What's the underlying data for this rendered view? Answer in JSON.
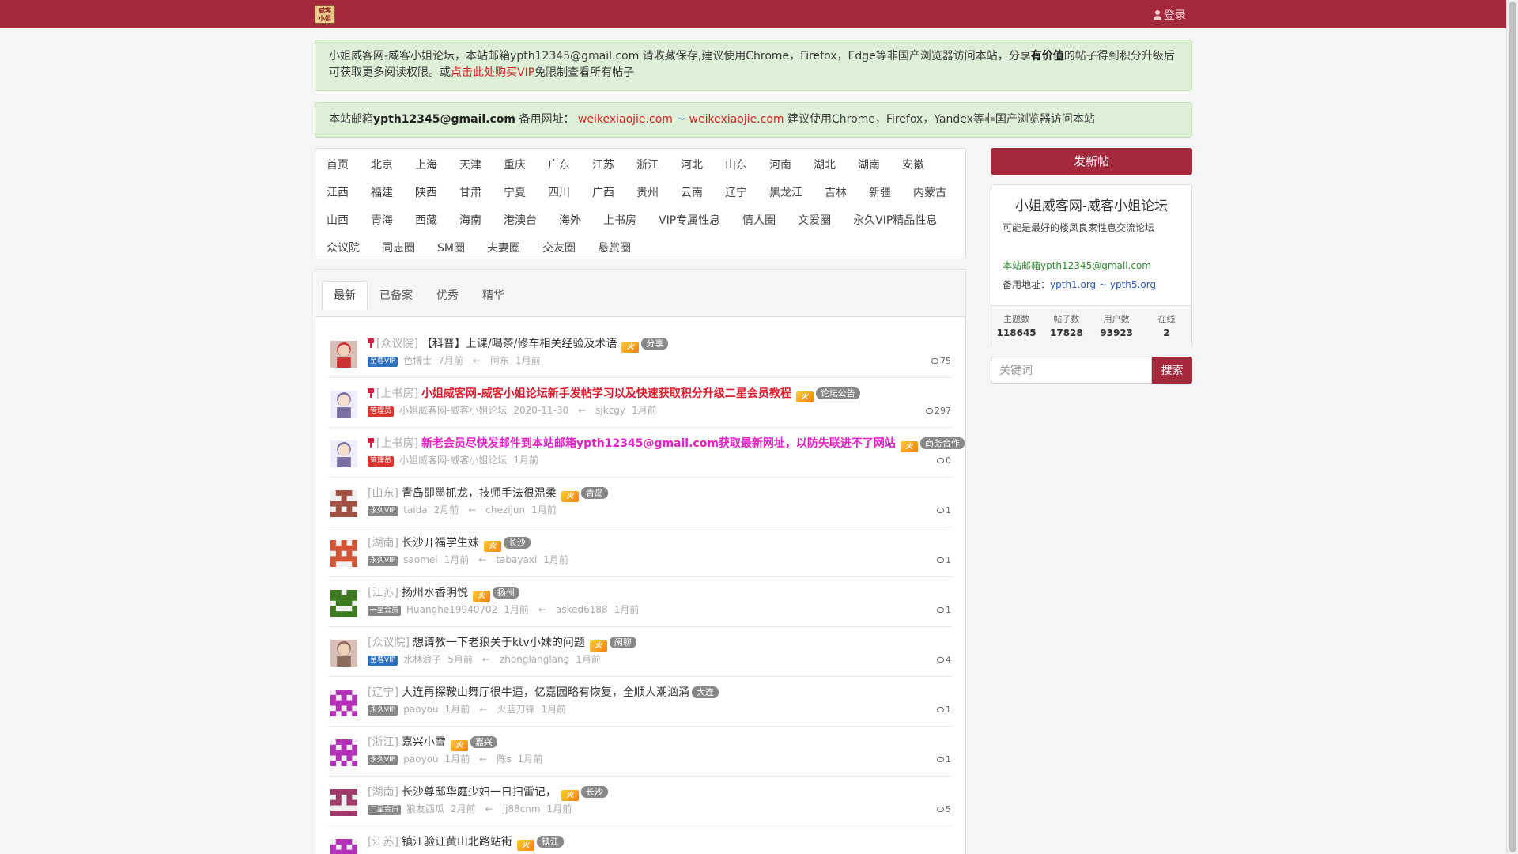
{
  "topbar": {
    "logo_text": "威客 小姐",
    "login_label": "登录"
  },
  "notice1": {
    "text_a": "小姐威客网-威客小姐论坛，本站邮箱ypth12345@gmail.com 请收藏保存,建议使用Chrome，Firefox，Edge等非国产浏览器访问本站，分享",
    "bold": "有价值",
    "text_b": "的帖子得到积分升级后可获取更多阅读权限。或",
    "link": "点击此处购买VIP",
    "text_c": "免限制查看所有帖子"
  },
  "notice2": {
    "prefix": "本站邮箱",
    "email": "ypth12345@gmail.com",
    "backup_label": " 备用网址： ",
    "link1": "weikexiaojie.com",
    "sep": " ~ ",
    "link2": "weikexiaojie.com",
    "suffix": " 建议使用Chrome，Firefox，Yandex等非国产浏览器访问本站"
  },
  "forums": [
    [
      "首页",
      "北京",
      "上海",
      "天津",
      "重庆",
      "广东",
      "江苏",
      "浙江",
      "河北",
      "山东",
      "河南",
      "湖北",
      "湖南",
      "安徽"
    ],
    [
      "江西",
      "福建",
      "陕西",
      "甘肃",
      "宁夏",
      "四川",
      "广西",
      "贵州",
      "云南",
      "辽宁",
      "黑龙江",
      "吉林",
      "新疆",
      "内蒙古"
    ],
    [
      "山西",
      "青海",
      "西藏",
      "海南",
      "港澳台",
      "海外",
      "上书房",
      "VIP专属性息",
      "情人圈",
      "文爱圈",
      "永久VIP精品性息"
    ],
    [
      "众议院",
      "同志圈",
      "SM圈",
      "夫妻圈",
      "交友圈",
      "悬赏圈"
    ]
  ],
  "tabs": [
    "最新",
    "已备案",
    "优秀",
    "精华"
  ],
  "threads": [
    {
      "pinned": true,
      "forum": "[众议院]",
      "title": "【科普】上课/喝茶/修车相关经验及术语",
      "style": "",
      "fire": "火",
      "tag": "分享",
      "role": "至尊VIP",
      "role_class": "zz",
      "author": "色博士",
      "time": "7月前",
      "arrow": "←",
      "last_user": "阿东",
      "last_time": "1月前",
      "count": "75",
      "avatar_color": "#c33",
      "avatar_type": "photo"
    },
    {
      "pinned": true,
      "forum": "[上书房]",
      "title": "小姐威客网-威客小姐论坛新手发帖学习以及快速获取积分升级二星会员教程",
      "style": "red",
      "fire": "火",
      "tag": "论坛公告",
      "role": "管理员",
      "role_class": "gl",
      "author": "小姐威客网-威客小姐论坛",
      "time": "2020-11-30",
      "arrow": "←",
      "last_user": "sjkcgy",
      "last_time": "1月前",
      "count": "297",
      "avatar_color": "#7a6fa0",
      "avatar_type": "girl"
    },
    {
      "pinned": true,
      "forum": "[上书房]",
      "title": "新老会员尽快发邮件到本站邮箱ypth12345@gmail.com获取最新网址，以防失联进不了网站",
      "style": "pink",
      "fire": "火",
      "tag": "商务合作",
      "role": "管理员",
      "role_class": "gl",
      "author": "小姐威客网-威客小姐论坛",
      "time": "1月前",
      "arrow": "",
      "last_user": "",
      "last_time": "",
      "count": "0",
      "avatar_color": "#7a6fa0",
      "avatar_type": "girl"
    },
    {
      "pinned": false,
      "forum": "[山东]",
      "title": "青岛即墨抓龙，技师手法很温柔",
      "style": "",
      "fire": "火",
      "tag": "青岛",
      "role": "永久VIP",
      "role_class": "yj",
      "author": "taida",
      "time": "2月前",
      "arrow": "←",
      "last_user": "chezijun",
      "last_time": "1月前",
      "count": "1",
      "avatar_color": "#a05040",
      "avatar_type": "pix1"
    },
    {
      "pinned": false,
      "forum": "[湖南]",
      "title": "长沙开福学生妹",
      "style": "",
      "fire": "火",
      "tag": "长沙",
      "role": "永久VIP",
      "role_class": "yj",
      "author": "saomei",
      "time": "1月前",
      "arrow": "←",
      "last_user": "tabayaxi",
      "last_time": "1月前",
      "count": "1",
      "avatar_color": "#d35432",
      "avatar_type": "pix2"
    },
    {
      "pinned": false,
      "forum": "[江苏]",
      "title": "扬州水香明悦",
      "style": "",
      "fire": "火",
      "tag": "扬州",
      "role": "一星会员",
      "role_class": "ex",
      "author": "Huanghe19940702",
      "time": "1月前",
      "arrow": "←",
      "last_user": "asked6188",
      "last_time": "1月前",
      "count": "1",
      "avatar_color": "#3b7a1e",
      "avatar_type": "pix3"
    },
    {
      "pinned": false,
      "forum": "[众议院]",
      "title": "想请教一下老狼关于ktv小妹的问题",
      "style": "",
      "fire": "火",
      "tag": "闲聊",
      "role": "至尊VIP",
      "role_class": "zz",
      "author": "水林浪子",
      "time": "5月前",
      "arrow": "←",
      "last_user": "zhonglanglang",
      "last_time": "1月前",
      "count": "4",
      "avatar_color": "#8a6a5a",
      "avatar_type": "photo2"
    },
    {
      "pinned": false,
      "forum": "[辽宁]",
      "title": "大连再探鞍山舞厅很牛逼，亿嘉园略有恢复，全顺人潮汹涌",
      "style": "",
      "fire": "",
      "tag": "大连",
      "role": "永久VIP",
      "role_class": "yj",
      "author": "paoyou",
      "time": "1月前",
      "arrow": "←",
      "last_user": "火蓝刀锋",
      "last_time": "1月前",
      "count": "1",
      "avatar_color": "#b530b8",
      "avatar_type": "pix4"
    },
    {
      "pinned": false,
      "forum": "[浙江]",
      "title": "嘉兴小雪",
      "style": "",
      "fire": "火",
      "tag": "嘉兴",
      "role": "永久VIP",
      "role_class": "yj",
      "author": "paoyou",
      "time": "1月前",
      "arrow": "←",
      "last_user": "陈s",
      "last_time": "1月前",
      "count": "1",
      "avatar_color": "#b530b8",
      "avatar_type": "pix4"
    },
    {
      "pinned": false,
      "forum": "[湖南]",
      "title": "长沙尊邸华庭少妇一日扫雷记，",
      "style": "",
      "fire": "火",
      "tag": "长沙",
      "role": "二星会员",
      "role_class": "ex",
      "author": "狼友西瓜",
      "time": "2月前",
      "arrow": "←",
      "last_user": "jj88cnm",
      "last_time": "1月前",
      "count": "5",
      "avatar_color": "#a03a6a",
      "avatar_type": "pix5"
    },
    {
      "pinned": false,
      "forum": "[江苏]",
      "title": "镇江验证黄山北路站街",
      "style": "",
      "fire": "火",
      "tag": "镇江",
      "role": "",
      "role_class": "yj",
      "author": "",
      "time": "",
      "arrow": "",
      "last_user": "",
      "last_time": "",
      "count": "",
      "avatar_color": "#b530b8",
      "avatar_type": "pix4"
    }
  ],
  "sidebar": {
    "post_button": "发新帖",
    "site_name": "小姐威客网-威客小姐论坛",
    "desc": "可能是最好的楼凤良家性息交流论坛",
    "email": "本站邮箱ypth12345@gmail.com",
    "backup_label": "备用地址：",
    "backup_link1": "ypth1.org",
    "backup_sep": " ~ ",
    "backup_link2": "ypth5.org",
    "stats": [
      {
        "label": "主题数",
        "value": "118645"
      },
      {
        "label": "帖子数",
        "value": "17828"
      },
      {
        "label": "用户数",
        "value": "93923"
      },
      {
        "label": "在线",
        "value": "2"
      }
    ],
    "search_placeholder": "关键词",
    "search_button": "搜索"
  }
}
